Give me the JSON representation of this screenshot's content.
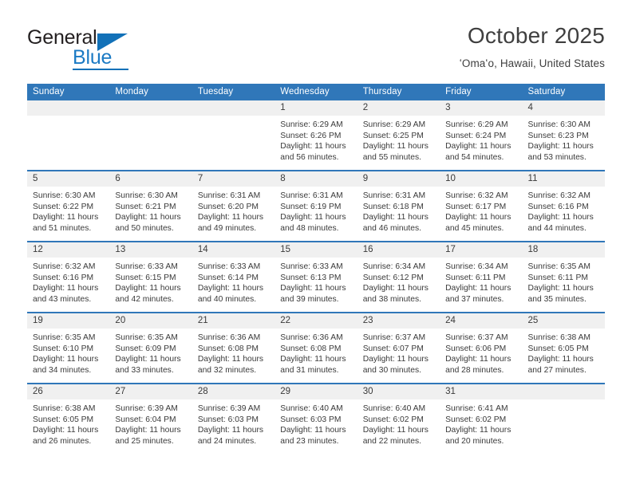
{
  "brand": {
    "name_part1": "General",
    "name_part2": "Blue"
  },
  "header": {
    "title": "October 2025",
    "subtitle": "ʻOmaʻo, Hawaii, United States"
  },
  "calendar": {
    "weekday_headers": [
      "Sunday",
      "Monday",
      "Tuesday",
      "Wednesday",
      "Thursday",
      "Friday",
      "Saturday"
    ],
    "accent_color": "#3077b9",
    "daynum_band_color": "#f0f0f0",
    "weeks": [
      [
        {
          "day": "",
          "empty": true
        },
        {
          "day": "",
          "empty": true
        },
        {
          "day": "",
          "empty": true
        },
        {
          "day": "1",
          "sunrise": "Sunrise: 6:29 AM",
          "sunset": "Sunset: 6:26 PM",
          "daylight": "Daylight: 11 hours and 56 minutes."
        },
        {
          "day": "2",
          "sunrise": "Sunrise: 6:29 AM",
          "sunset": "Sunset: 6:25 PM",
          "daylight": "Daylight: 11 hours and 55 minutes."
        },
        {
          "day": "3",
          "sunrise": "Sunrise: 6:29 AM",
          "sunset": "Sunset: 6:24 PM",
          "daylight": "Daylight: 11 hours and 54 minutes."
        },
        {
          "day": "4",
          "sunrise": "Sunrise: 6:30 AM",
          "sunset": "Sunset: 6:23 PM",
          "daylight": "Daylight: 11 hours and 53 minutes."
        }
      ],
      [
        {
          "day": "5",
          "sunrise": "Sunrise: 6:30 AM",
          "sunset": "Sunset: 6:22 PM",
          "daylight": "Daylight: 11 hours and 51 minutes."
        },
        {
          "day": "6",
          "sunrise": "Sunrise: 6:30 AM",
          "sunset": "Sunset: 6:21 PM",
          "daylight": "Daylight: 11 hours and 50 minutes."
        },
        {
          "day": "7",
          "sunrise": "Sunrise: 6:31 AM",
          "sunset": "Sunset: 6:20 PM",
          "daylight": "Daylight: 11 hours and 49 minutes."
        },
        {
          "day": "8",
          "sunrise": "Sunrise: 6:31 AM",
          "sunset": "Sunset: 6:19 PM",
          "daylight": "Daylight: 11 hours and 48 minutes."
        },
        {
          "day": "9",
          "sunrise": "Sunrise: 6:31 AM",
          "sunset": "Sunset: 6:18 PM",
          "daylight": "Daylight: 11 hours and 46 minutes."
        },
        {
          "day": "10",
          "sunrise": "Sunrise: 6:32 AM",
          "sunset": "Sunset: 6:17 PM",
          "daylight": "Daylight: 11 hours and 45 minutes."
        },
        {
          "day": "11",
          "sunrise": "Sunrise: 6:32 AM",
          "sunset": "Sunset: 6:16 PM",
          "daylight": "Daylight: 11 hours and 44 minutes."
        }
      ],
      [
        {
          "day": "12",
          "sunrise": "Sunrise: 6:32 AM",
          "sunset": "Sunset: 6:16 PM",
          "daylight": "Daylight: 11 hours and 43 minutes."
        },
        {
          "day": "13",
          "sunrise": "Sunrise: 6:33 AM",
          "sunset": "Sunset: 6:15 PM",
          "daylight": "Daylight: 11 hours and 42 minutes."
        },
        {
          "day": "14",
          "sunrise": "Sunrise: 6:33 AM",
          "sunset": "Sunset: 6:14 PM",
          "daylight": "Daylight: 11 hours and 40 minutes."
        },
        {
          "day": "15",
          "sunrise": "Sunrise: 6:33 AM",
          "sunset": "Sunset: 6:13 PM",
          "daylight": "Daylight: 11 hours and 39 minutes."
        },
        {
          "day": "16",
          "sunrise": "Sunrise: 6:34 AM",
          "sunset": "Sunset: 6:12 PM",
          "daylight": "Daylight: 11 hours and 38 minutes."
        },
        {
          "day": "17",
          "sunrise": "Sunrise: 6:34 AM",
          "sunset": "Sunset: 6:11 PM",
          "daylight": "Daylight: 11 hours and 37 minutes."
        },
        {
          "day": "18",
          "sunrise": "Sunrise: 6:35 AM",
          "sunset": "Sunset: 6:11 PM",
          "daylight": "Daylight: 11 hours and 35 minutes."
        }
      ],
      [
        {
          "day": "19",
          "sunrise": "Sunrise: 6:35 AM",
          "sunset": "Sunset: 6:10 PM",
          "daylight": "Daylight: 11 hours and 34 minutes."
        },
        {
          "day": "20",
          "sunrise": "Sunrise: 6:35 AM",
          "sunset": "Sunset: 6:09 PM",
          "daylight": "Daylight: 11 hours and 33 minutes."
        },
        {
          "day": "21",
          "sunrise": "Sunrise: 6:36 AM",
          "sunset": "Sunset: 6:08 PM",
          "daylight": "Daylight: 11 hours and 32 minutes."
        },
        {
          "day": "22",
          "sunrise": "Sunrise: 6:36 AM",
          "sunset": "Sunset: 6:08 PM",
          "daylight": "Daylight: 11 hours and 31 minutes."
        },
        {
          "day": "23",
          "sunrise": "Sunrise: 6:37 AM",
          "sunset": "Sunset: 6:07 PM",
          "daylight": "Daylight: 11 hours and 30 minutes."
        },
        {
          "day": "24",
          "sunrise": "Sunrise: 6:37 AM",
          "sunset": "Sunset: 6:06 PM",
          "daylight": "Daylight: 11 hours and 28 minutes."
        },
        {
          "day": "25",
          "sunrise": "Sunrise: 6:38 AM",
          "sunset": "Sunset: 6:05 PM",
          "daylight": "Daylight: 11 hours and 27 minutes."
        }
      ],
      [
        {
          "day": "26",
          "sunrise": "Sunrise: 6:38 AM",
          "sunset": "Sunset: 6:05 PM",
          "daylight": "Daylight: 11 hours and 26 minutes."
        },
        {
          "day": "27",
          "sunrise": "Sunrise: 6:39 AM",
          "sunset": "Sunset: 6:04 PM",
          "daylight": "Daylight: 11 hours and 25 minutes."
        },
        {
          "day": "28",
          "sunrise": "Sunrise: 6:39 AM",
          "sunset": "Sunset: 6:03 PM",
          "daylight": "Daylight: 11 hours and 24 minutes."
        },
        {
          "day": "29",
          "sunrise": "Sunrise: 6:40 AM",
          "sunset": "Sunset: 6:03 PM",
          "daylight": "Daylight: 11 hours and 23 minutes."
        },
        {
          "day": "30",
          "sunrise": "Sunrise: 6:40 AM",
          "sunset": "Sunset: 6:02 PM",
          "daylight": "Daylight: 11 hours and 22 minutes."
        },
        {
          "day": "31",
          "sunrise": "Sunrise: 6:41 AM",
          "sunset": "Sunset: 6:02 PM",
          "daylight": "Daylight: 11 hours and 20 minutes."
        },
        {
          "day": "",
          "empty": true
        }
      ]
    ]
  }
}
